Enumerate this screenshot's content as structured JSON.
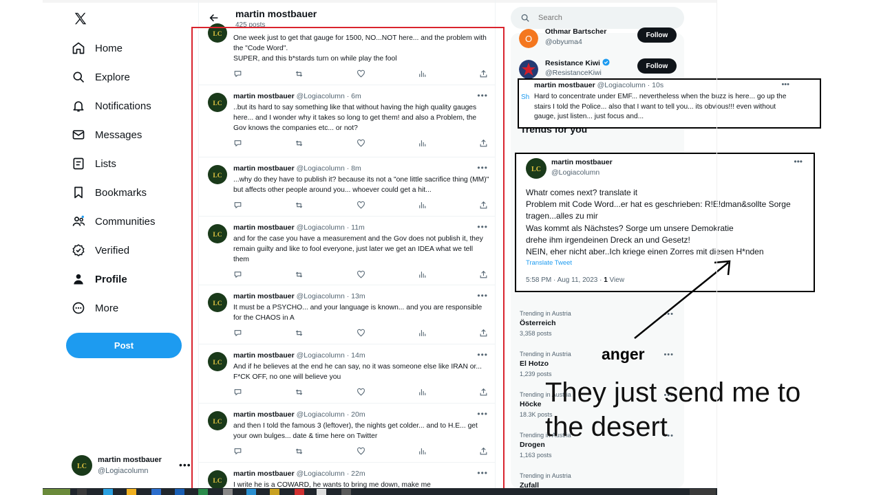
{
  "window": {
    "title": "martin mostbauer"
  },
  "leftnav": {
    "items": [
      {
        "label": "Home"
      },
      {
        "label": "Explore"
      },
      {
        "label": "Notifications"
      },
      {
        "label": "Messages"
      },
      {
        "label": "Lists"
      },
      {
        "label": "Bookmarks"
      },
      {
        "label": "Communities"
      },
      {
        "label": "Verified"
      },
      {
        "label": "Profile"
      },
      {
        "label": "More"
      }
    ],
    "post_label": "Post",
    "account": {
      "name": "martin mostbauer",
      "handle": "@Logiacolumn",
      "avatar_text": "LC"
    }
  },
  "profile_header": {
    "name": "martin mostbauer",
    "posts": "425 posts"
  },
  "tweets": [
    {
      "name": "martin mostbauer",
      "handle": "@Logiacolumn",
      "time": "",
      "text": "One week just to get that gauge for 1500, NO...NOT here... and the problem with the \"Code Word\".\nSUPER, and this b*stards turn on while play the fool"
    },
    {
      "name": "martin mostbauer",
      "handle": "@Logiacolumn",
      "time": "6m",
      "text": "..but its hard to say something like that without having the high quality gauges here... and I wonder why it takes so long to get them! and also a Problem, the Gov knows the companies etc... or not?"
    },
    {
      "name": "martin mostbauer",
      "handle": "@Logiacolumn",
      "time": "8m",
      "text": "...why do they have to publish it? because its not a \"one little sacrifice thing (MM)\" but affects other people around you... whoever could get a hit..."
    },
    {
      "name": "martin mostbauer",
      "handle": "@Logiacolumn",
      "time": "11m",
      "text": "and for the case you have a measurement and the Gov does not publish it, they remain guilty and like to fool everyone, just later we get an IDEA what we tell them"
    },
    {
      "name": "martin mostbauer",
      "handle": "@Logiacolumn",
      "time": "13m",
      "text": "It must be a PSYCHO... and your language is known... and you are responsible for the CHAOS in A"
    },
    {
      "name": "martin mostbauer",
      "handle": "@Logiacolumn",
      "time": "14m",
      "text": "And if he believes at the end he can say, no it was someone else like IRAN or... F*CK OFF, no one will believe you"
    },
    {
      "name": "martin mostbauer",
      "handle": "@Logiacolumn",
      "time": "20m",
      "text": "and then I told the famous 3 (leftover), the nights get colder... and to H.E... get your own bulges... date & time here on Twitter"
    },
    {
      "name": "martin mostbauer",
      "handle": "@Logiacolumn",
      "time": "22m",
      "text": "I write he is a COWARD, he wants to bring me down, make me"
    }
  ],
  "search": {
    "placeholder": "Search"
  },
  "who_to_follow": [
    {
      "name": "Othmar Bartscher",
      "handle": "@obyuma4",
      "button": "Follow",
      "avatar_text": "O",
      "avatar_color": "#f4771f"
    },
    {
      "name": "Resistance Kiwi",
      "handle": "@ResistanceKiwi",
      "button": "Follow",
      "verified": true,
      "avatar_color": "#243b73"
    }
  ],
  "trends_title": "Trends for you",
  "trends": [
    {
      "context": "Trending in Austria",
      "name": "Österreich",
      "count": "3,358 posts"
    },
    {
      "context": "Trending in Austria",
      "name": "El Hotzo",
      "count": "1,239 posts"
    },
    {
      "context": "Trending in Austria",
      "name": "Höcke",
      "count": "18.3K posts"
    },
    {
      "context": "Trending in Austria",
      "name": "Drogen",
      "count": "1,163 posts"
    },
    {
      "context": "Trending in Austria",
      "name": "Zufall",
      "count": ""
    }
  ],
  "overlay_small": {
    "name": "martin mostbauer",
    "handle": "@Logiacolumn · 10s",
    "side_label": "Sh",
    "text": "Hard to concentrate under EMF... nevertheless when the buzz is here... go up the stairs I told the Police... also that I want to tell you... its obvious!!! even without gauge, just listen... just focus and..."
  },
  "overlay_big": {
    "name": "martin mostbauer",
    "handle": "@Logiacolumn",
    "avatar_text": "LC",
    "lines": [
      "Whatr comes next? translate it",
      "Problem mit Code Word...er hat es geschrieben: R!E!dman&sollte Sorge tragen...alles zu mir",
      "Was kommt als Nächstes? Sorge um unsere Demokratie",
      "drehe ihm irgendeinen Dreck an und Gesetz!",
      "NEIN, eher nicht aber..Ich kriege einen Zorres mit diesen H*nden"
    ],
    "translate": "Translate Tweet",
    "timestamp": "5:58 PM · Aug 11, 2023 · ",
    "views_count": "1",
    "views_label": " View"
  },
  "annotations": {
    "anger": "anger",
    "handwritten": "They just send me to the desert"
  },
  "colors": {
    "accent": "#1d9bf0",
    "highlight_box": "#d9232d",
    "avatar_bg": "#1a3a1a",
    "avatar_text": "#e0c341"
  }
}
